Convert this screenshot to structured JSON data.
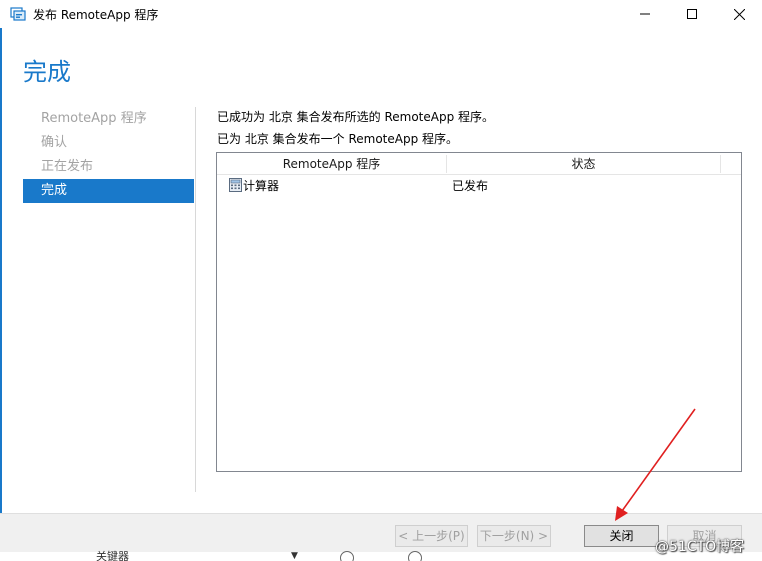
{
  "window": {
    "title": "发布 RemoteApp 程序",
    "controls": [
      "minimize-icon",
      "maximize-icon",
      "close-icon"
    ]
  },
  "page": {
    "heading": "完成"
  },
  "nav": {
    "items": [
      {
        "label": "RemoteApp 程序",
        "state": "inactive"
      },
      {
        "label": "确认",
        "state": "inactive"
      },
      {
        "label": "正在发布",
        "state": "inactive"
      },
      {
        "label": "完成",
        "state": "active"
      }
    ]
  },
  "messages": {
    "line1": "已成功为 北京 集合发布所选的 RemoteApp 程序。",
    "line2": "已为 北京 集合发布一个 RemoteApp 程序。"
  },
  "table": {
    "columns": [
      "RemoteApp 程序",
      "状态"
    ],
    "rows": [
      {
        "name": "计算器",
        "status": "已发布",
        "icon": "calculator-icon"
      }
    ]
  },
  "footer": {
    "prev_label": "< 上一步(P)",
    "next_label": "下一步(N) >",
    "close_label": "关闭",
    "cancel_label": "取消"
  },
  "background": {
    "partial_text": "关键器",
    "glyph": "▼"
  },
  "watermark": "@51CTO博客",
  "colors": {
    "accent": "#1979ca",
    "annotation_arrow": "#e02020"
  }
}
